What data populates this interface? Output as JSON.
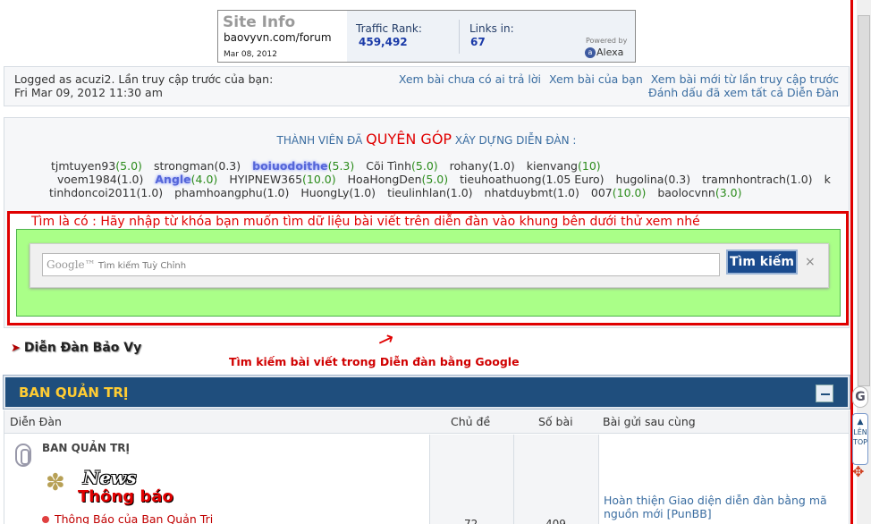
{
  "siteinfo": {
    "title": "Site Info",
    "url": "baovyvn.com/forum",
    "date": "Mar 08, 2012",
    "rank_label": "Traffic Rank:",
    "rank": "459,492",
    "links_label": "Links in:",
    "links": "67",
    "powered": "Powered by",
    "alexa": "Alexa"
  },
  "login": {
    "text": "Logged as acuzi2. Lần truy cập trước của bạn: Fri Mar 09, 2012 11:30 am",
    "link1": "Xem bài chưa có ai trả lời",
    "link2": "Xem bài của bạn",
    "link3": "Xem bài mới từ lần truy cập trước",
    "link4": "Đánh dấu đã xem tất cả Diễn Đàn"
  },
  "donors": {
    "head_pre": "THÀNH VIÊN ĐÃ",
    "head_big": "QUYÊN GÓP",
    "head_post": "XÂY DỰNG DIỄN ĐÀN :",
    "row1": [
      {
        "name": "tjmtuyen93",
        "value": "(5.0)",
        "green": true
      },
      {
        "name": "strongman",
        "value": "(0.3)",
        "green": false
      },
      {
        "name": "boiuodoithe",
        "value": "(5.3)",
        "green": true,
        "blur": true
      },
      {
        "name": "Cõi Tình",
        "value": "(5.0)",
        "green": true
      },
      {
        "name": "rohany",
        "value": "(1.0)",
        "green": false
      },
      {
        "name": "kienvang",
        "value": "(10)",
        "green": true
      }
    ],
    "row2": [
      {
        "name": "voem1984",
        "value": "(1.0)",
        "green": false
      },
      {
        "name": "Angle",
        "value": "(4.0)",
        "green": true,
        "blur": true
      },
      {
        "name": "HYIPNEW365",
        "value": "(10.0)",
        "green": true
      },
      {
        "name": "HoaHongDen",
        "value": "(5.0)",
        "green": true
      },
      {
        "name": "tieuhoathuong",
        "value": "(1.05 Euro)",
        "green": false
      },
      {
        "name": "hugolina",
        "value": "(0.3)",
        "green": false
      },
      {
        "name": "tramnhontrach",
        "value": "(1.0)",
        "green": false
      },
      {
        "name": "k",
        "value": "",
        "green": false
      }
    ],
    "row3": [
      {
        "name": "tinhdoncoi2011",
        "value": "(1.0)",
        "green": false
      },
      {
        "name": "phamhoangphu",
        "value": "(1.0)",
        "green": false
      },
      {
        "name": "HuongLy",
        "value": "(1.0)",
        "green": false
      },
      {
        "name": "tieulinhlan",
        "value": "(1.0)",
        "green": false
      },
      {
        "name": "nhatduybmt",
        "value": "(1.0)",
        "green": false
      },
      {
        "name": "007",
        "value": "(10.0)",
        "green": true
      },
      {
        "name": "baolocvnn",
        "value": "(3.0)",
        "green": true
      }
    ]
  },
  "search": {
    "note": "Tìm là có : Hãy nhập từ khóa bạn muốn tìm dữ liệu bài viết trên diễn đàn vào khung bên dưới thử xem nhé",
    "google": "Google™",
    "placeholder": "Tìm kiếm Tuỳ Chỉnh",
    "button": "Tìm kiếm",
    "close": "×"
  },
  "brand": "Diễn Đàn Bảo Vy",
  "caption": "Tìm kiếm bài viết trong Diễn đàn bằng Google",
  "forum": {
    "header": "BAN QUẢN TRỊ",
    "col_forum": "Diễn Đàn",
    "col_topics": "Chủ đề",
    "col_posts": "Số bài",
    "col_last": "Bài gửi sau cùng",
    "row": {
      "name": "BAN QUẢN TRỊ",
      "logo_top": "News",
      "logo_bottom": "Thông báo",
      "subforum": "Thông Báo của Ban Quản Trị",
      "topics": "72",
      "posts": "409",
      "last_post": "Hoàn thiện Giao diện diễn đàn bằng mã nguồn mới [PunBB]"
    }
  },
  "side": {
    "badge": "G",
    "top_line1": "LÊN",
    "top_line2": "TOP"
  }
}
